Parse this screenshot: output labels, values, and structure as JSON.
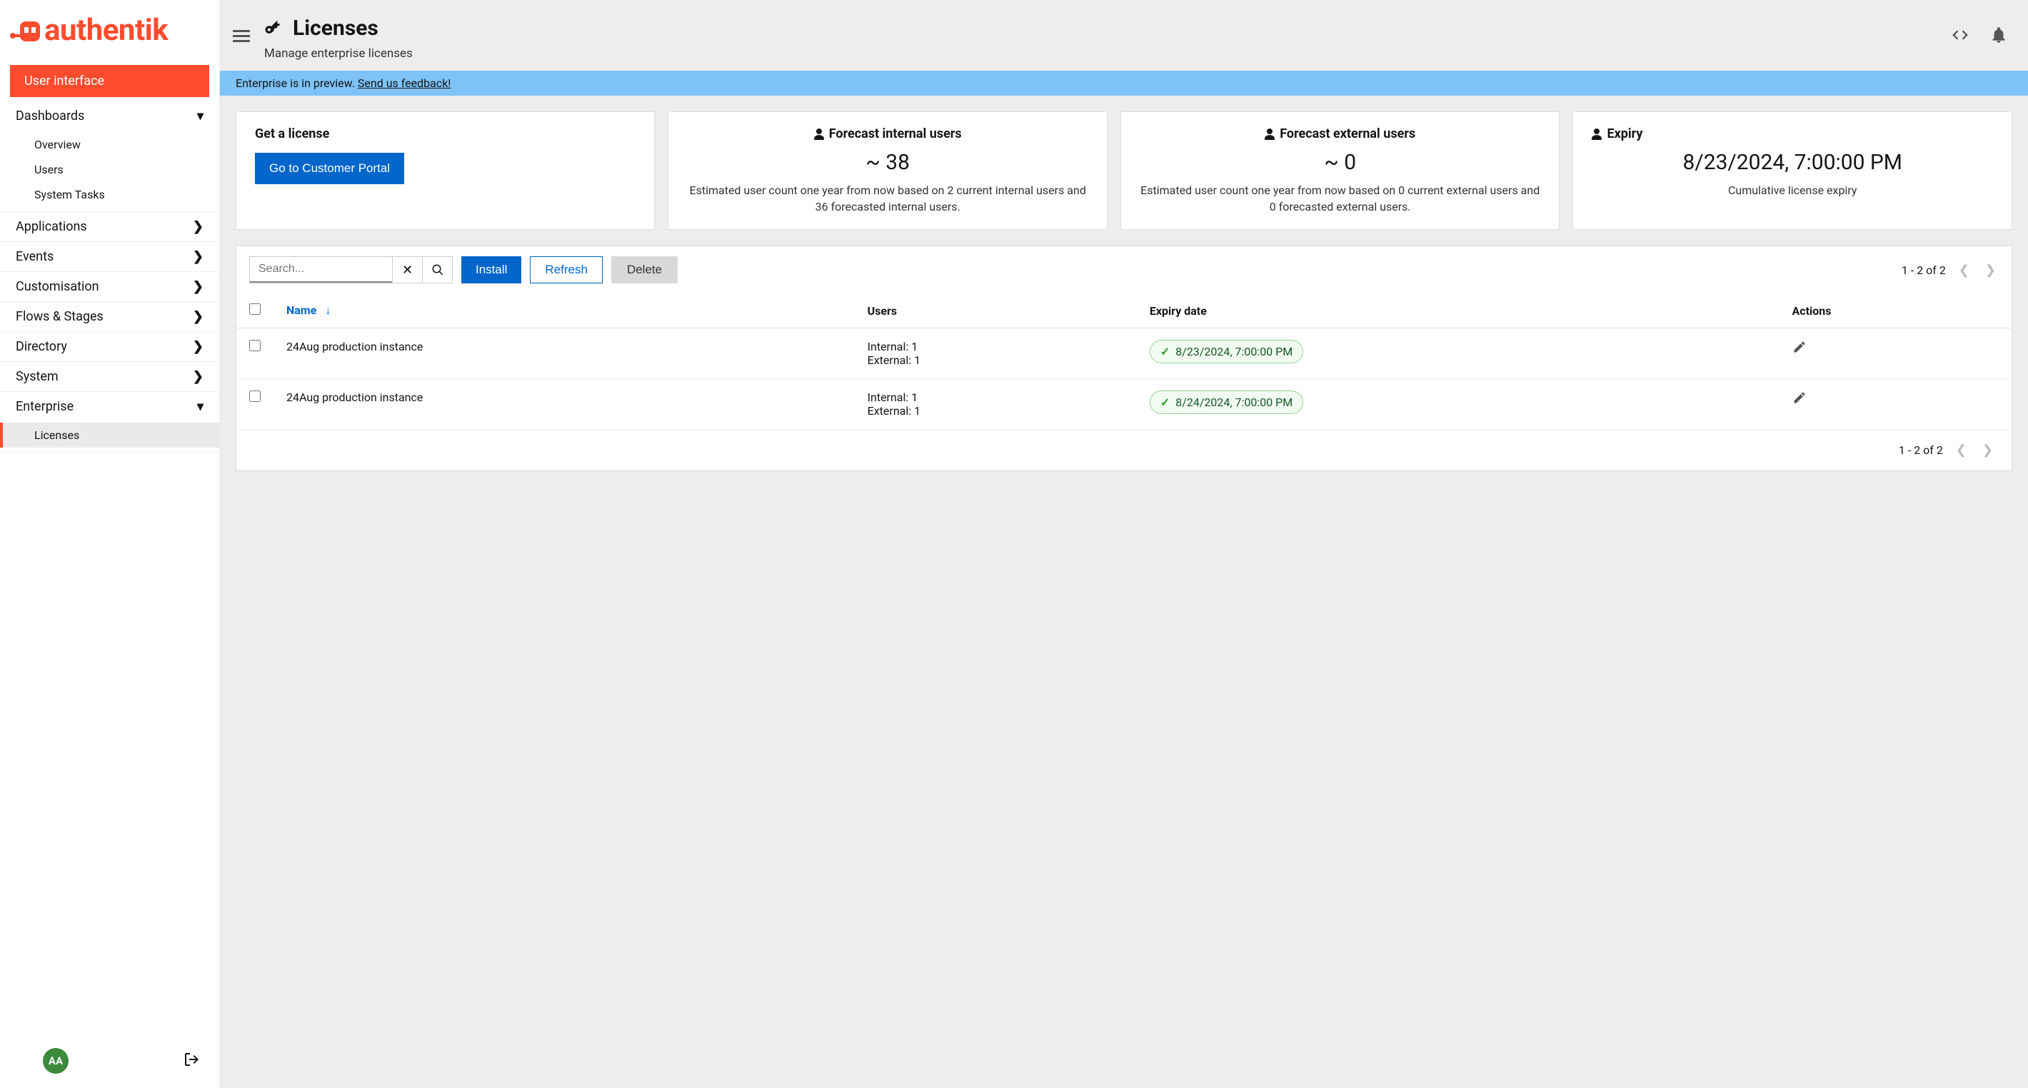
{
  "brand": "authentik",
  "sidebar": {
    "primary": "User interface",
    "groups": [
      {
        "label": "Dashboards",
        "expanded": true,
        "items": [
          "Overview",
          "Users",
          "System Tasks"
        ]
      },
      {
        "label": "Applications",
        "expanded": false
      },
      {
        "label": "Events",
        "expanded": false
      },
      {
        "label": "Customisation",
        "expanded": false
      },
      {
        "label": "Flows & Stages",
        "expanded": false
      },
      {
        "label": "Directory",
        "expanded": false
      },
      {
        "label": "System",
        "expanded": false
      },
      {
        "label": "Enterprise",
        "expanded": true,
        "items": [
          "Licenses"
        ],
        "active_item": "Licenses"
      }
    ]
  },
  "avatar_initials": "AA",
  "header": {
    "title": "Licenses",
    "subtitle": "Manage enterprise licenses"
  },
  "banner": {
    "text": "Enterprise is in preview. ",
    "link": "Send us feedback!"
  },
  "cards": {
    "get_license": {
      "title": "Get a license",
      "button": "Go to Customer Portal"
    },
    "forecast_internal": {
      "title": "Forecast internal users",
      "value": "~ 38",
      "desc": "Estimated user count one year from now based on 2 current internal users and 36 forecasted internal users."
    },
    "forecast_external": {
      "title": "Forecast external users",
      "value": "~ 0",
      "desc": "Estimated user count one year from now based on 0 current external users and 0 forecasted external users."
    },
    "expiry": {
      "title": "Expiry",
      "value": "8/23/2024, 7:00:00 PM",
      "desc": "Cumulative license expiry"
    }
  },
  "toolbar": {
    "search_placeholder": "Search...",
    "install": "Install",
    "refresh": "Refresh",
    "delete": "Delete",
    "pagination": "1 - 2 of 2"
  },
  "table": {
    "columns": {
      "name": "Name",
      "users": "Users",
      "expiry": "Expiry date",
      "actions": "Actions"
    },
    "rows": [
      {
        "name": "24Aug production instance",
        "users_internal": "Internal: 1",
        "users_external": "External: 1",
        "expiry": "8/23/2024, 7:00:00 PM"
      },
      {
        "name": "24Aug production instance",
        "users_internal": "Internal: 1",
        "users_external": "External: 1",
        "expiry": "8/24/2024, 7:00:00 PM"
      }
    ]
  }
}
